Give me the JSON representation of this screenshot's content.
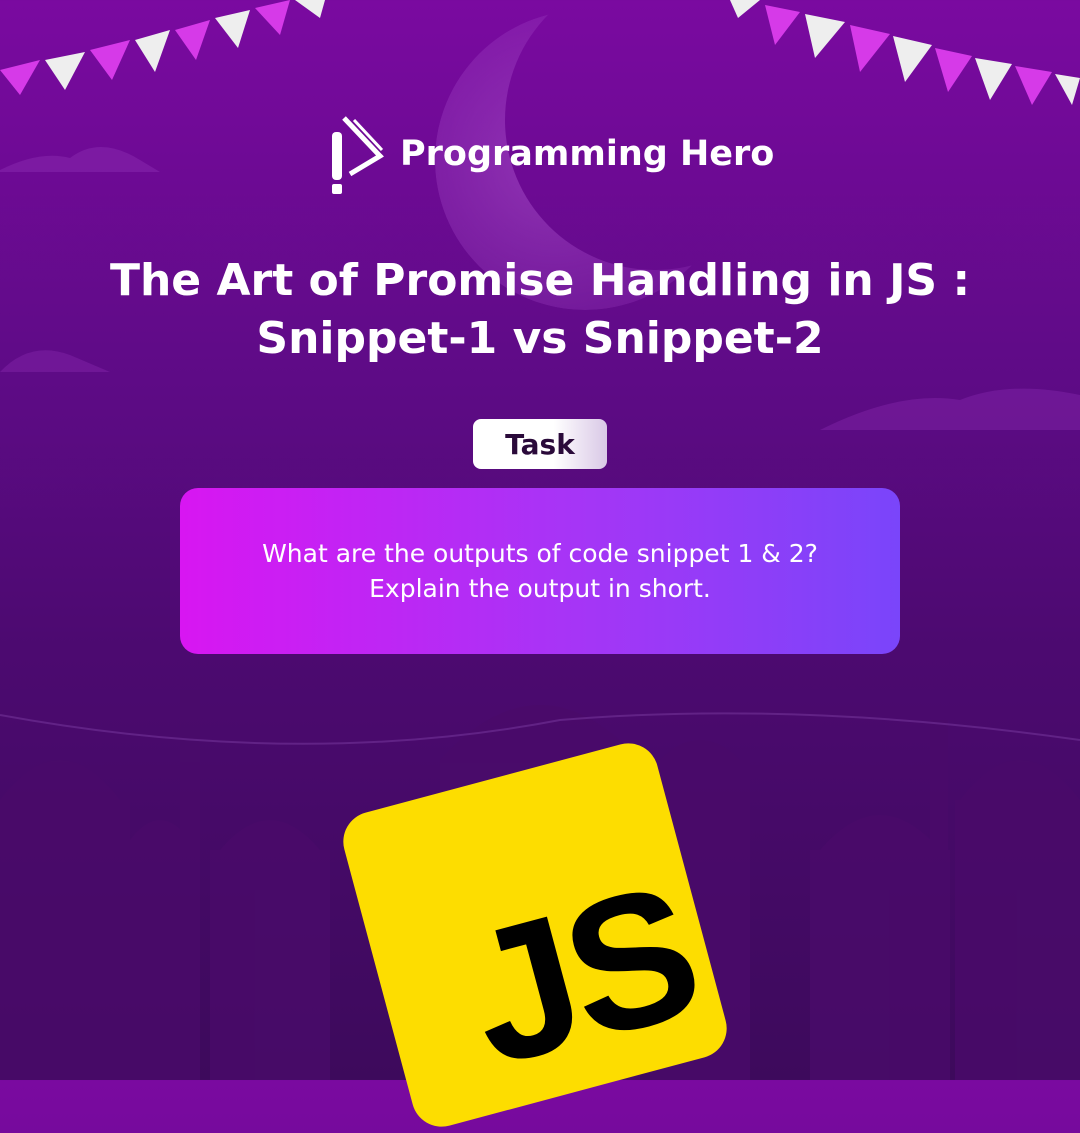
{
  "brand": {
    "name": "Programming Hero",
    "icon": "programming-hero-logo"
  },
  "title": {
    "line1": "The Art of Promise Handling in JS :",
    "line2": "Snippet-1 vs Snippet-2"
  },
  "task": {
    "label": "Task"
  },
  "card": {
    "line1": "What are the outputs of code snippet 1 & 2?",
    "line2": "Explain the output in short."
  },
  "js_logo": {
    "text": "JS",
    "color": "#fddd00"
  },
  "colors": {
    "background": "#5e0b86",
    "card_start": "#d816f2",
    "card_end": "#7a45fa"
  }
}
